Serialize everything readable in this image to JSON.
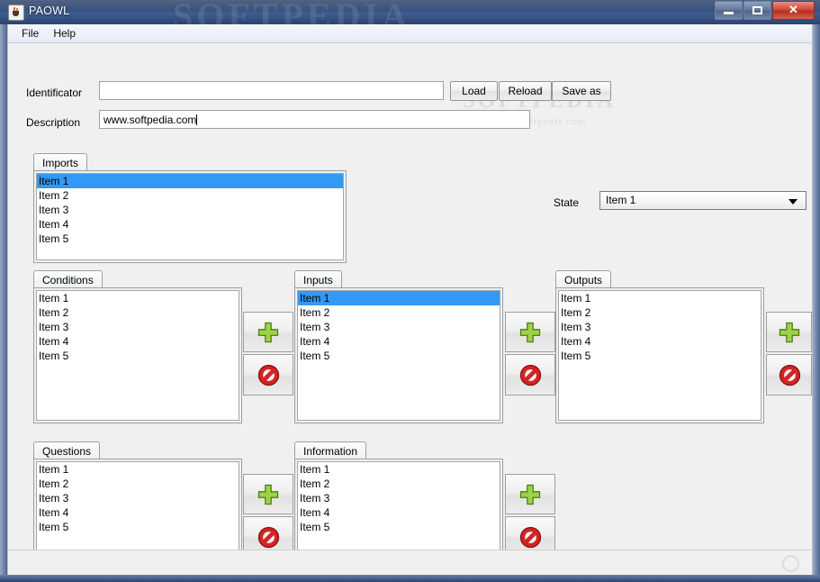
{
  "window": {
    "title": "PAOWL",
    "icon": "java-coffee-cup-icon",
    "watermark_top": "SOFTPEDIA",
    "watermark_mid": "SOFTPEDIA",
    "watermark_mid_sub": "www.softpedia.com",
    "controls": {
      "minimize": "minimize-icon",
      "maximize": "maximize-icon",
      "close": "✕"
    }
  },
  "menubar": {
    "items": [
      {
        "label": "File"
      },
      {
        "label": "Help"
      }
    ]
  },
  "form": {
    "identificator_label": "Identificator",
    "identificator_value": "",
    "identificator_placeholder": "",
    "description_label": "Description",
    "description_value": "www.softpedia.com",
    "buttons": [
      {
        "label": "Load"
      },
      {
        "label": "Reload"
      },
      {
        "label": "Save as"
      }
    ]
  },
  "state": {
    "label": "State",
    "selected": "Item 1",
    "options": [
      "Item 1"
    ]
  },
  "panels": {
    "imports": {
      "tab_label": "Imports",
      "items": [
        "Item 1",
        "Item 2",
        "Item 3",
        "Item 4",
        "Item 5"
      ],
      "selected_index": 0
    },
    "conditions": {
      "tab_label": "Conditions",
      "items": [
        "Item 1",
        "Item 2",
        "Item 3",
        "Item 4",
        "Item 5"
      ],
      "selected_index": -1
    },
    "inputs": {
      "tab_label": "Inputs",
      "items": [
        "Item 1",
        "Item 2",
        "Item 3",
        "Item 4",
        "Item 5"
      ],
      "selected_index": 0
    },
    "outputs": {
      "tab_label": "Outputs",
      "items": [
        "Item 1",
        "Item 2",
        "Item 3",
        "Item 4",
        "Item 5"
      ],
      "selected_index": -1
    },
    "questions": {
      "tab_label": "Questions",
      "items": [
        "Item 1",
        "Item 2",
        "Item 3",
        "Item 4",
        "Item 5"
      ],
      "selected_index": -1
    },
    "information": {
      "tab_label": "Information",
      "items": [
        "Item 1",
        "Item 2",
        "Item 3",
        "Item 4",
        "Item 5"
      ],
      "selected_index": -1
    }
  },
  "icons": {
    "add": "green-plus-icon",
    "remove": "red-deny-icon",
    "resize_grip": "resize-grip-icon"
  },
  "colors": {
    "selection": "#3399f5",
    "titlebar": "#2e4a79",
    "close_button": "#c9483a",
    "panel_background": "#f0f0f0",
    "add_icon": "#79b71c",
    "remove_icon": "#cc2222"
  }
}
